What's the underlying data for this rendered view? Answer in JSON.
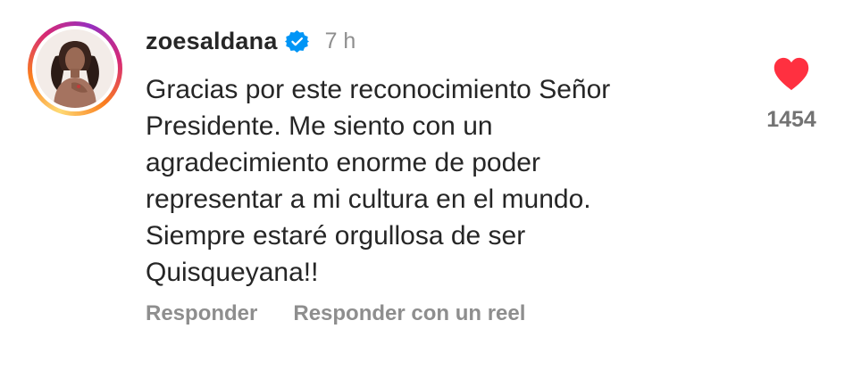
{
  "comment": {
    "username": "zoesaldana",
    "time": "7 h",
    "text_lines": [
      "Gracias por este reconocimiento Señor",
      "Presidente. Me siento con un",
      "agradecimiento enorme de poder",
      "representar a mi cultura en el mundo.",
      "Siempre estaré orgullosa de ser",
      "Quisqueyana!!"
    ],
    "like_count": "1454",
    "actions": {
      "reply": "Responder",
      "reply_reel": "Responder con un reel"
    }
  },
  "icons": {
    "verified": "verified-badge-icon",
    "like": "heart-icon"
  },
  "colors": {
    "verified_blue": "#0095f6",
    "heart_red": "#ff3040",
    "secondary_text": "#8e8e8e",
    "primary_text": "#262626"
  }
}
